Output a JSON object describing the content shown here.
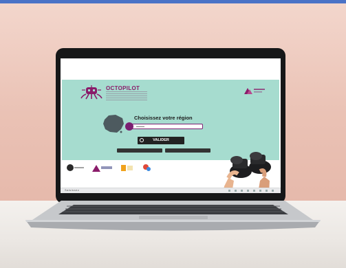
{
  "scene": {
    "topbar_color": "#4a73c7",
    "wall_color": "#efcbbf",
    "desk_color": "#f0ece8",
    "laptop_color": "#b6b8bb"
  },
  "website": {
    "brand_name": "OCTOPILOT",
    "region_title": "Choisissez votre région",
    "validate_label": "VALIDER",
    "background_color": "#a6dccf",
    "accent_color": "#7a1f71"
  },
  "taskbar": {
    "label": "Saisissez"
  },
  "icons": {
    "brand": "octopus-logo-icon",
    "map": "france-map-icon",
    "pin": "location-pin-icon",
    "binoculars": "binoculars-icon"
  }
}
